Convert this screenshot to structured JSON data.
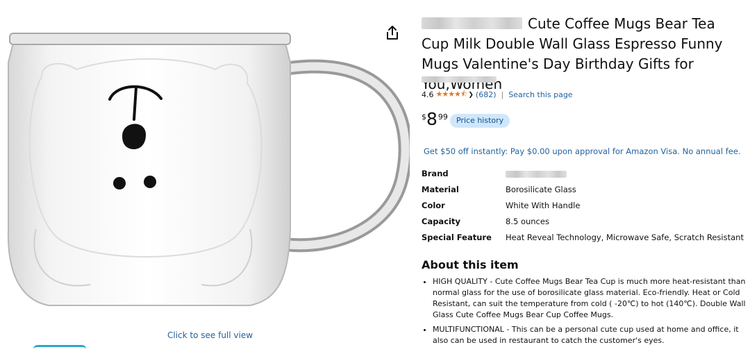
{
  "product": {
    "title_text": "Cute Coffee Mugs Bear Tea Cup Milk Double Wall Glass Espresso Funny Mugs Valentine's Day Birthday Gifts for You,Women",
    "rating_value": "4.6",
    "rating_stars": "★★★★⯪",
    "rating_count": "(682)",
    "search_page_label": "Search this page",
    "price": {
      "currency": "$",
      "whole": "8",
      "fraction": "99"
    },
    "price_history_label": "Price history",
    "promo_text": "Get $50 off instantly: Pay $0.00 upon approval for Amazon Visa. No annual fee."
  },
  "image": {
    "click_to_view_label": "Click to see full view"
  },
  "specs": [
    {
      "key": "Brand",
      "value": ""
    },
    {
      "key": "Material",
      "value": "Borosilicate Glass"
    },
    {
      "key": "Color",
      "value": "White With Handle"
    },
    {
      "key": "Capacity",
      "value": "8.5 ounces"
    },
    {
      "key": "Special Feature",
      "value": "Heat Reveal Technology, Microwave Safe, Scratch Resistant"
    }
  ],
  "about": {
    "heading": "About this item",
    "bullets": [
      "HIGH QUALITY - Cute Coffee Mugs Bear Tea Cup is much more heat-resistant than normal glass for the use of borosilicate glass material. Eco-friendly. Heat or Cold Resistant, can suit the temperature from cold ( -20℃) to hot (140℃). Double Wall Glass Cute Coffee Mugs Bear Cup Coffee Mugs.",
      "MULTIFUNCTIONAL - This can be a personal cute cup used at home and office, it also can be used in restaurant to catch the customer's eyes."
    ]
  },
  "icons": {
    "share": "share-icon",
    "rating_dropdown": "chevron-down-icon"
  },
  "colors": {
    "link": "#2162a1",
    "star": "#de7921",
    "price_history_bg": "#cfe7fb"
  }
}
